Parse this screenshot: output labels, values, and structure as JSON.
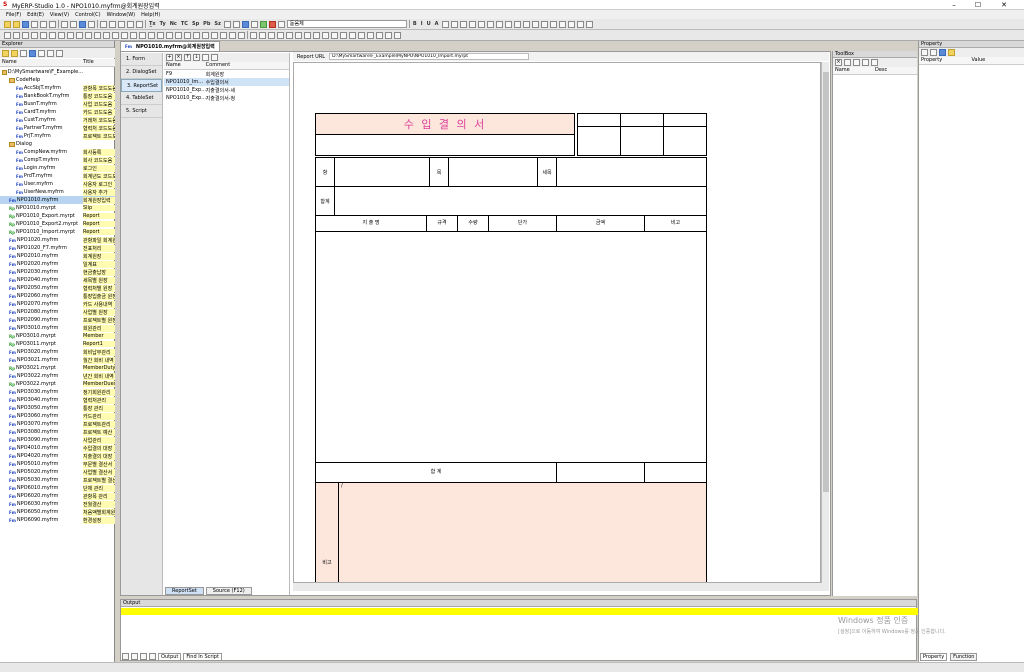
{
  "window": {
    "title": "MyERP-Studio 1.0 - NPO1010.myfrm@회계원장입력",
    "controls": [
      "–",
      "☐",
      "✕"
    ]
  },
  "menu": [
    "File(F)",
    "Edit(E)",
    "View(V)",
    "Control(C)",
    "Window(W)",
    "Help(H)"
  ],
  "toolbar": {
    "font_name": "돋움체",
    "text_buttons": [
      "T̲x",
      "Ty",
      "Nc",
      "TC",
      "Sp",
      "Pb",
      "Sz"
    ],
    "format_buttons": [
      "B",
      "I",
      "U",
      "A"
    ]
  },
  "explorer": {
    "title": "Explorer",
    "col_name": "Name",
    "col_title": "Title",
    "items": [
      {
        "name": "D:\\MySmartware\\F_Example...",
        "title": "",
        "type": "folder",
        "level": 0
      },
      {
        "name": "CodeHelp",
        "title": "",
        "type": "folder",
        "level": 1
      },
      {
        "name": "AccSbjT.myfrm",
        "title": "관항목 코드도움",
        "type": "fm",
        "level": 2
      },
      {
        "name": "BankBookT.myfrm",
        "title": "통장 코드도움",
        "type": "fm",
        "level": 2
      },
      {
        "name": "BusnT.myfrm",
        "title": "사업 코드도움",
        "type": "fm",
        "level": 2
      },
      {
        "name": "CardT.myfrm",
        "title": "카드 코드도움",
        "type": "fm",
        "level": 2
      },
      {
        "name": "CustT.myfrm",
        "title": "거래처 코드도움",
        "type": "fm",
        "level": 2
      },
      {
        "name": "PartnerT.myfrm",
        "title": "협력처 코드도움",
        "type": "fm",
        "level": 2
      },
      {
        "name": "PrjT.myfrm",
        "title": "프로젝트 코드도움",
        "type": "fm",
        "level": 2
      },
      {
        "name": "Dialog",
        "title": "",
        "type": "folder",
        "level": 1
      },
      {
        "name": "CompNew.myfrm",
        "title": "회사등록",
        "type": "fm",
        "level": 2
      },
      {
        "name": "CompT.myfrm",
        "title": "회사 코드도움",
        "type": "fm",
        "level": 2
      },
      {
        "name": "Login.myfrm",
        "title": "로그인",
        "type": "fm",
        "level": 2
      },
      {
        "name": "PrdT.myfrm",
        "title": "회계년도 코드도움",
        "type": "fm",
        "level": 2
      },
      {
        "name": "User.myfrm",
        "title": "사용자 로그인",
        "type": "fm",
        "level": 2
      },
      {
        "name": "UserNew.myfrm",
        "title": "사용자 추가",
        "type": "fm",
        "level": 2
      },
      {
        "name": "NPO1010.myfrm",
        "title": "회계원장입력",
        "type": "fm",
        "level": 1,
        "sel": true
      },
      {
        "name": "NPO1010.myrpt",
        "title": "Slip",
        "type": "rp",
        "level": 1
      },
      {
        "name": "NPO1010_Export.myrpt",
        "title": "Report",
        "type": "rp",
        "level": 1
      },
      {
        "name": "NPO1010_Export2.myrpt",
        "title": "Report",
        "type": "rp",
        "level": 1
      },
      {
        "name": "NPO1010_Import.myrpt",
        "title": "Report",
        "type": "rp",
        "level": 1
      },
      {
        "name": "NPO1020.myfrm",
        "title": "관항파일 회계원장",
        "type": "fm",
        "level": 1
      },
      {
        "name": "NPO1020_F7.myfrm",
        "title": "전표처리",
        "type": "fm",
        "level": 1
      },
      {
        "name": "NPO2010.myfrm",
        "title": "회계원장",
        "type": "fm",
        "level": 1
      },
      {
        "name": "NPO2020.myfrm",
        "title": "일계표",
        "type": "fm",
        "level": 1
      },
      {
        "name": "NPO2030.myfrm",
        "title": "현금출납장",
        "type": "fm",
        "level": 1
      },
      {
        "name": "NPO2040.myfrm",
        "title": "세목별 원장",
        "type": "fm",
        "level": 1
      },
      {
        "name": "NPO2050.myfrm",
        "title": "협력처별 원장",
        "type": "fm",
        "level": 1
      },
      {
        "name": "NPO2060.myfrm",
        "title": "통장입출금 원장",
        "type": "fm",
        "level": 1
      },
      {
        "name": "NPO2070.myfrm",
        "title": "카드 사용내역",
        "type": "fm",
        "level": 1
      },
      {
        "name": "NPO2080.myfrm",
        "title": "사업별 원장",
        "type": "fm",
        "level": 1
      },
      {
        "name": "NPO2090.myfrm",
        "title": "프로젝트별 원장",
        "type": "fm",
        "level": 1
      },
      {
        "name": "NPO3010.myfrm",
        "title": "회원관리",
        "type": "fm",
        "level": 1
      },
      {
        "name": "NPO3010.myrpt",
        "title": "Member",
        "type": "rp",
        "level": 1
      },
      {
        "name": "NPO3011.myrpt",
        "title": "Report1",
        "type": "rp",
        "level": 1
      },
      {
        "name": "NPO3020.myfrm",
        "title": "회비납부관리",
        "type": "fm",
        "level": 1
      },
      {
        "name": "NPO3021.myfrm",
        "title": "월간 회비 내역",
        "type": "fm",
        "level": 1
      },
      {
        "name": "NPO3021.myrpt",
        "title": "MemberDuty",
        "type": "rp",
        "level": 1
      },
      {
        "name": "NPO3022.myfrm",
        "title": "년간 회비 내역",
        "type": "fm",
        "level": 1
      },
      {
        "name": "NPO3022.myrpt",
        "title": "MemberDues",
        "type": "rp",
        "level": 1
      },
      {
        "name": "NPO3030.myfrm",
        "title": "정기회원관리",
        "type": "fm",
        "level": 1
      },
      {
        "name": "NPO3040.myfrm",
        "title": "협력처관리",
        "type": "fm",
        "level": 1
      },
      {
        "name": "NPO3050.myfrm",
        "title": "통장 관리",
        "type": "fm",
        "level": 1
      },
      {
        "name": "NPO3060.myfrm",
        "title": "카드관리",
        "type": "fm",
        "level": 1
      },
      {
        "name": "NPO3070.myfrm",
        "title": "프로젝트관리",
        "type": "fm",
        "level": 1
      },
      {
        "name": "NPO3080.myfrm",
        "title": "프로젝트 예산",
        "type": "fm",
        "level": 1
      },
      {
        "name": "NPO3090.myfrm",
        "title": "사업관리",
        "type": "fm",
        "level": 1
      },
      {
        "name": "NPO4010.myfrm",
        "title": "수입결의 대장",
        "type": "fm",
        "level": 1
      },
      {
        "name": "NPO4020.myfrm",
        "title": "지출결의 대장",
        "type": "fm",
        "level": 1
      },
      {
        "name": "NPO5010.myfrm",
        "title": "부문별 결산서",
        "type": "fm",
        "level": 1
      },
      {
        "name": "NPO5020.myfrm",
        "title": "사업별 결산서",
        "type": "fm",
        "level": 1
      },
      {
        "name": "NPO5030.myfrm",
        "title": "프로젝트별 결산",
        "type": "fm",
        "level": 1
      },
      {
        "name": "NPO6010.myfrm",
        "title": "단체 관리",
        "type": "fm",
        "level": 1
      },
      {
        "name": "NPO6020.myfrm",
        "title": "관항목 관리",
        "type": "fm",
        "level": 1
      },
      {
        "name": "NPO6030.myfrm",
        "title": "전월결산",
        "type": "fm",
        "level": 1
      },
      {
        "name": "NPO6050.myfrm",
        "title": "처음액별회계원장",
        "type": "fm",
        "level": 1
      },
      {
        "name": "NPO6090.myfrm",
        "title": "환경설정",
        "type": "fm",
        "level": 1
      }
    ]
  },
  "doc_tab": {
    "label": "NPO1010.myfrm@회계원장입력"
  },
  "left_nav": [
    "1. Form",
    "2. DialogSet",
    "3. ReportSet",
    "4. TableSet",
    "5. Script"
  ],
  "report_list": {
    "col_name": "Name",
    "col_comment": "Comment",
    "rows": [
      {
        "name": "F9",
        "comment": "회계원장"
      },
      {
        "name": "NPO1010_Im...",
        "comment": "수입결의서",
        "sel": true
      },
      {
        "name": "NPO1010_Exp...",
        "comment": "지출결의서-세"
      },
      {
        "name": "NPO1010_Exp...",
        "comment": "지출결의서-청"
      }
    ]
  },
  "report_url": {
    "label": "Report URL",
    "value": "D:\\MySmartware\\F_Example\\MyNPO\\NPO1010_Import.myrpt"
  },
  "report": {
    "title": "수 입 결 의 서",
    "label_hang": "항",
    "label_mok": "목",
    "label_semok": "세목",
    "label_hapgye": "합계",
    "columns": [
      "지 출 명",
      "규격",
      "수량",
      "단가",
      "금액",
      "비고"
    ],
    "total_label": "합 계",
    "remark_label": "비고",
    "remark_slash": "/"
  },
  "bottom_tabs": [
    "ReportSet",
    "Source (F12)"
  ],
  "toolbox": {
    "title": "ToolBox",
    "col_name": "Name",
    "col_desc": "Desc"
  },
  "property": {
    "title": "Property",
    "col_property": "Property",
    "col_value": "Value",
    "tabs": [
      "Property",
      "Function"
    ]
  },
  "output": {
    "title": "Output",
    "tabs": [
      "Output",
      "Find In Script"
    ]
  },
  "windows_activation": {
    "line1": "Windows 정품 인증",
    "line2": "[설정]으로 이동하여 Windows를 정품 인증합니다."
  }
}
